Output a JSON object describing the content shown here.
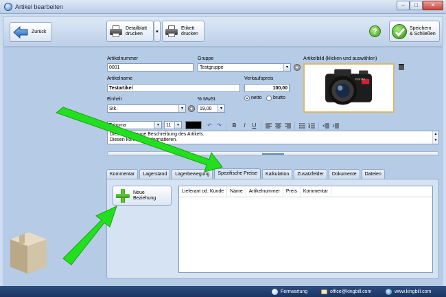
{
  "window": {
    "title": "Artikel bearbeiten",
    "min": "–",
    "max": "□",
    "close": "✕"
  },
  "toolbar": {
    "back_label": "Zurück",
    "print_detail_label": [
      "Detailblatt",
      "drucken"
    ],
    "print_label_label": [
      "Etikett",
      "drucken"
    ],
    "help_label": "?",
    "save_label": [
      "Speichern",
      "& Schließen"
    ],
    "dropdown_arrow": "▾"
  },
  "form": {
    "artikelnummer_label": "Artikelnummer",
    "artikelnummer_value": "0001",
    "gruppe_label": "Gruppe",
    "gruppe_value": "Testgruppe",
    "artikelbild_label": "Artikelbild (klicken und auswählen)",
    "artikelname_label": "Artikelname",
    "artikelname_value": "Testartikel",
    "verkaufspreis_label": "Verkaufspreis",
    "verkaufspreis_value": "100,00",
    "einheit_label": "Einheit",
    "einheit_value": "Stk.",
    "mwst_label": "% MwSt",
    "mwst_value": "19,00",
    "netto_label": "netto",
    "brutto_label": "brutto"
  },
  "editor": {
    "font": "Tahoma",
    "size": "11",
    "bold": "B",
    "italic": "I",
    "underline": "U",
    "undo": "↶",
    "redo": "↷",
    "line1": "Dies ist die lange Beschreibung des Artikels.",
    "line2": "Diesen können Sie formatieren."
  },
  "tabs": [
    "Kommentar",
    "Lagerstand",
    "Lagerbewegung",
    "Spezifische Preise",
    "Kalkulation",
    "Zusatzfelder",
    "Dokumente",
    "Dateien"
  ],
  "panel": {
    "new_button": [
      "Neue",
      "Beziehung"
    ],
    "columns": [
      "Lieferant od. Kunde",
      "Name",
      "Artikelnummer",
      "Preis",
      "Kommentar"
    ]
  },
  "statusbar": {
    "support": "Fernwartung",
    "email": "office@kingbill.com",
    "web": "www.kingbill.com"
  },
  "colors": {
    "accent": "#2d4d80",
    "panel": "#b6cbe6",
    "arrow": "#22e01e",
    "text_color": "#000000"
  }
}
